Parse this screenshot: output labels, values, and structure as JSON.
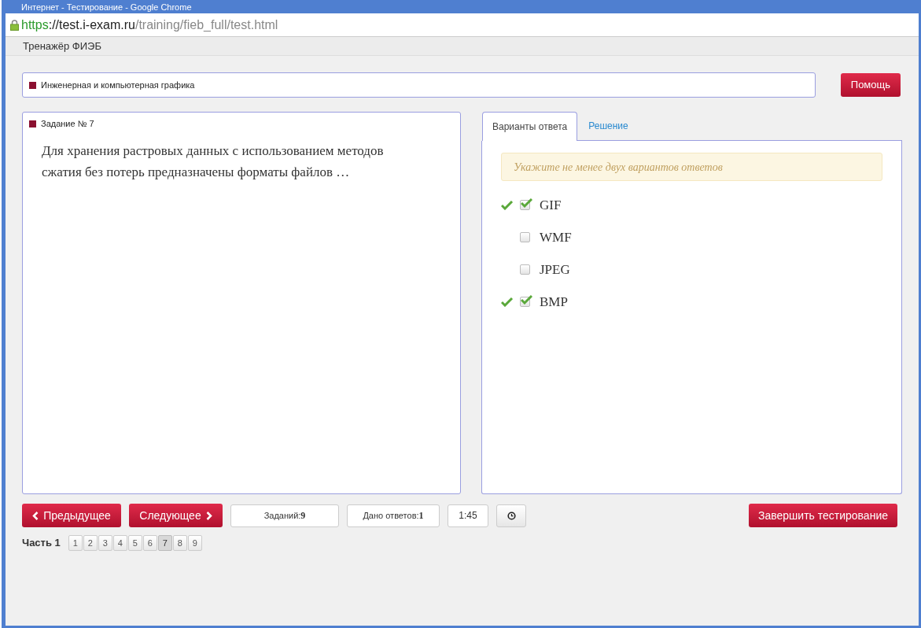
{
  "window": {
    "title": "Интернет - Тестирование - Google Chrome"
  },
  "address_bar": {
    "scheme": "https",
    "host": "://test.i-exam.ru",
    "path": "/training/fieb_full/test.html"
  },
  "app_title": "Тренажёр ФИЭБ",
  "discipline": "Инженерная и компьютерная графика",
  "help_button": "Помощь",
  "task": {
    "title": "Задание № 7",
    "text": "Для хранения растровых данных с использованием методов сжатия без потерь предназначены форматы файлов …"
  },
  "tabs": [
    {
      "label": "Варианты ответа",
      "selected": true
    },
    {
      "label": "Решение",
      "selected": false
    }
  ],
  "hint": "Укажите не менее двух вариантов ответов",
  "options": [
    {
      "label": "GIF",
      "checked": true,
      "correct": true
    },
    {
      "label": "WMF",
      "checked": false,
      "correct": false
    },
    {
      "label": "JPEG",
      "checked": false,
      "correct": false
    },
    {
      "label": "BMP",
      "checked": true,
      "correct": true
    }
  ],
  "nav": {
    "prev": "Предыдущее",
    "next": "Следующее",
    "tasks_label": "Заданий:",
    "tasks_count": "9",
    "answers_label": "Дано ответов:",
    "answers_count": "1",
    "time": "1:45",
    "finish": "Завершить тестирование"
  },
  "part_label": "Часть 1",
  "pages": [
    {
      "label": "1",
      "selected": false
    },
    {
      "label": "2",
      "selected": false
    },
    {
      "label": "3",
      "selected": false
    },
    {
      "label": "4",
      "selected": false
    },
    {
      "label": "5",
      "selected": false
    },
    {
      "label": "6",
      "selected": false
    },
    {
      "label": "7",
      "selected": true
    },
    {
      "label": "8",
      "selected": false
    },
    {
      "label": "9",
      "selected": false
    }
  ]
}
